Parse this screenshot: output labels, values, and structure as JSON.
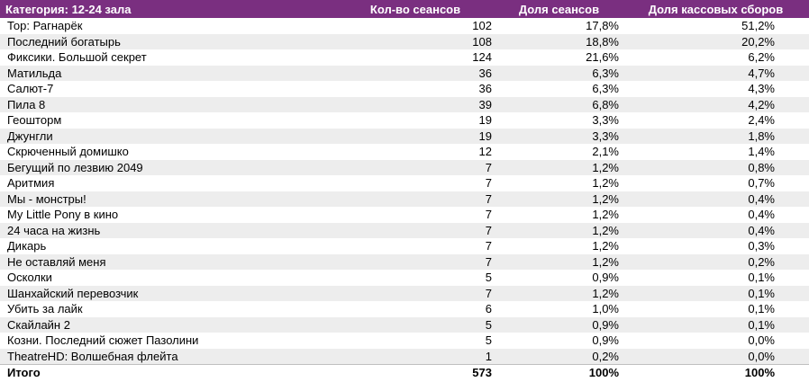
{
  "header": {
    "category": "Категория: 12-24 зала",
    "col_sessions": "Кол-во сеансов",
    "col_sessions_share": "Доля сеансов",
    "col_box_share": "Доля кассовых сборов"
  },
  "rows": [
    {
      "name": "Тор: Рагнарёк",
      "sessions": "102",
      "share": "17,8%",
      "box": "51,2%"
    },
    {
      "name": "Последний богатырь",
      "sessions": "108",
      "share": "18,8%",
      "box": "20,2%"
    },
    {
      "name": "Фиксики. Большой секрет",
      "sessions": "124",
      "share": "21,6%",
      "box": "6,2%"
    },
    {
      "name": "Матильда",
      "sessions": "36",
      "share": "6,3%",
      "box": "4,7%"
    },
    {
      "name": "Салют-7",
      "sessions": "36",
      "share": "6,3%",
      "box": "4,3%"
    },
    {
      "name": "Пила 8",
      "sessions": "39",
      "share": "6,8%",
      "box": "4,2%"
    },
    {
      "name": "Геошторм",
      "sessions": "19",
      "share": "3,3%",
      "box": "2,4%"
    },
    {
      "name": "Джунгли",
      "sessions": "19",
      "share": "3,3%",
      "box": "1,8%"
    },
    {
      "name": "Скрюченный домишко",
      "sessions": "12",
      "share": "2,1%",
      "box": "1,4%"
    },
    {
      "name": "Бегущий по лезвию 2049",
      "sessions": "7",
      "share": "1,2%",
      "box": "0,8%"
    },
    {
      "name": "Аритмия",
      "sessions": "7",
      "share": "1,2%",
      "box": "0,7%"
    },
    {
      "name": "Мы - монстры!",
      "sessions": "7",
      "share": "1,2%",
      "box": "0,4%"
    },
    {
      "name": "My Little Pony в кино",
      "sessions": "7",
      "share": "1,2%",
      "box": "0,4%"
    },
    {
      "name": "24 часа на жизнь",
      "sessions": "7",
      "share": "1,2%",
      "box": "0,4%"
    },
    {
      "name": "Дикарь",
      "sessions": "7",
      "share": "1,2%",
      "box": "0,3%"
    },
    {
      "name": "Не оставляй меня",
      "sessions": "7",
      "share": "1,2%",
      "box": "0,2%"
    },
    {
      "name": "Осколки",
      "sessions": "5",
      "share": "0,9%",
      "box": "0,1%"
    },
    {
      "name": "Шанхайский перевозчик",
      "sessions": "7",
      "share": "1,2%",
      "box": "0,1%"
    },
    {
      "name": "Убить за лайк",
      "sessions": "6",
      "share": "1,0%",
      "box": "0,1%"
    },
    {
      "name": "Скайлайн 2",
      "sessions": "5",
      "share": "0,9%",
      "box": "0,1%"
    },
    {
      "name": "Козни. Последний сюжет Пазолини",
      "sessions": "5",
      "share": "0,9%",
      "box": "0,0%"
    },
    {
      "name": "TheatreHD: Волшебная флейта",
      "sessions": "1",
      "share": "0,2%",
      "box": "0,0%"
    }
  ],
  "total": {
    "name": "Итого",
    "sessions": "573",
    "share": "100%",
    "box": "100%"
  }
}
